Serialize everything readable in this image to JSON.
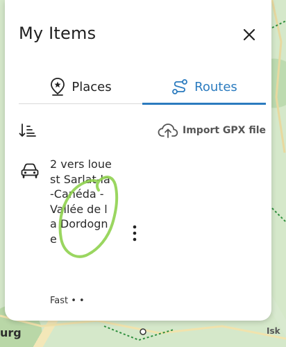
{
  "panel": {
    "title": "My Items",
    "close_icon": "close-icon"
  },
  "tabs": [
    {
      "label": "Places",
      "icon": "map-pin-star-icon",
      "active": false
    },
    {
      "label": "Routes",
      "icon": "route-icon",
      "active": true
    }
  ],
  "toolbar": {
    "sort_icon": "sort-icon",
    "import_label": "Import GPX file",
    "import_icon": "cloud-upload-icon"
  },
  "routes": [
    {
      "name": "2 vers louest Sarlat-la-Canéda - Vallée de la Dordogne",
      "mode_icon": "car-icon",
      "meta": "Fast • •"
    }
  ],
  "map": {
    "label_left": "urg",
    "label_right": "Isk"
  },
  "colors": {
    "accent": "#2b7bbf",
    "annotation": "#8fd14f"
  }
}
